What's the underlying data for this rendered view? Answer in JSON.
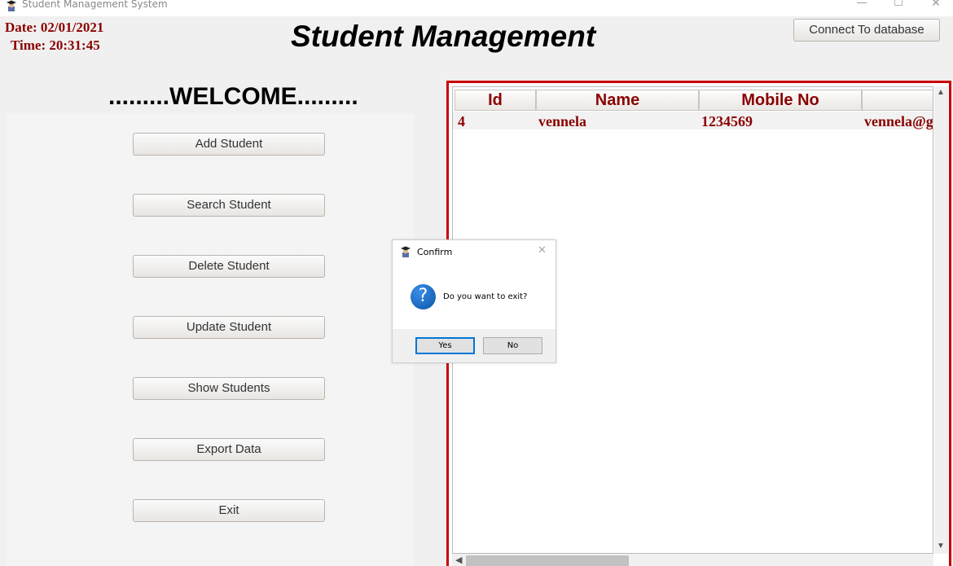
{
  "window": {
    "title": "Student Management System",
    "controls": {
      "minimize": "—",
      "maximize": "☐",
      "close": "✕"
    }
  },
  "header": {
    "date": "Date: 02/01/2021",
    "time": "Time: 20:31:45",
    "title": "Student Management",
    "connect_label": "Connect To database"
  },
  "welcome": ".........WELCOME.........",
  "menu": {
    "add": "Add Student",
    "search": "Search Student",
    "delete": "Delete Student",
    "update": "Update Student",
    "show": "Show Students",
    "export": "Export Data",
    "exit": "Exit"
  },
  "table": {
    "headers": [
      "Id",
      "Name",
      "Mobile No",
      ""
    ],
    "rows": [
      [
        "4",
        "vennela",
        "1234569",
        "vennela@g"
      ]
    ]
  },
  "dialog": {
    "title": "Confirm",
    "message": "Do you want to exit?",
    "question_glyph": "?",
    "yes": "Yes",
    "no": "No",
    "close": "✕"
  },
  "colors": {
    "accent": "#8b0000",
    "table_border": "#cc0000",
    "dialog_focus": "#0078d7"
  },
  "icons": [
    "student-avatar-icon",
    "question-icon",
    "close-icon",
    "minimize-icon",
    "maximize-icon"
  ]
}
